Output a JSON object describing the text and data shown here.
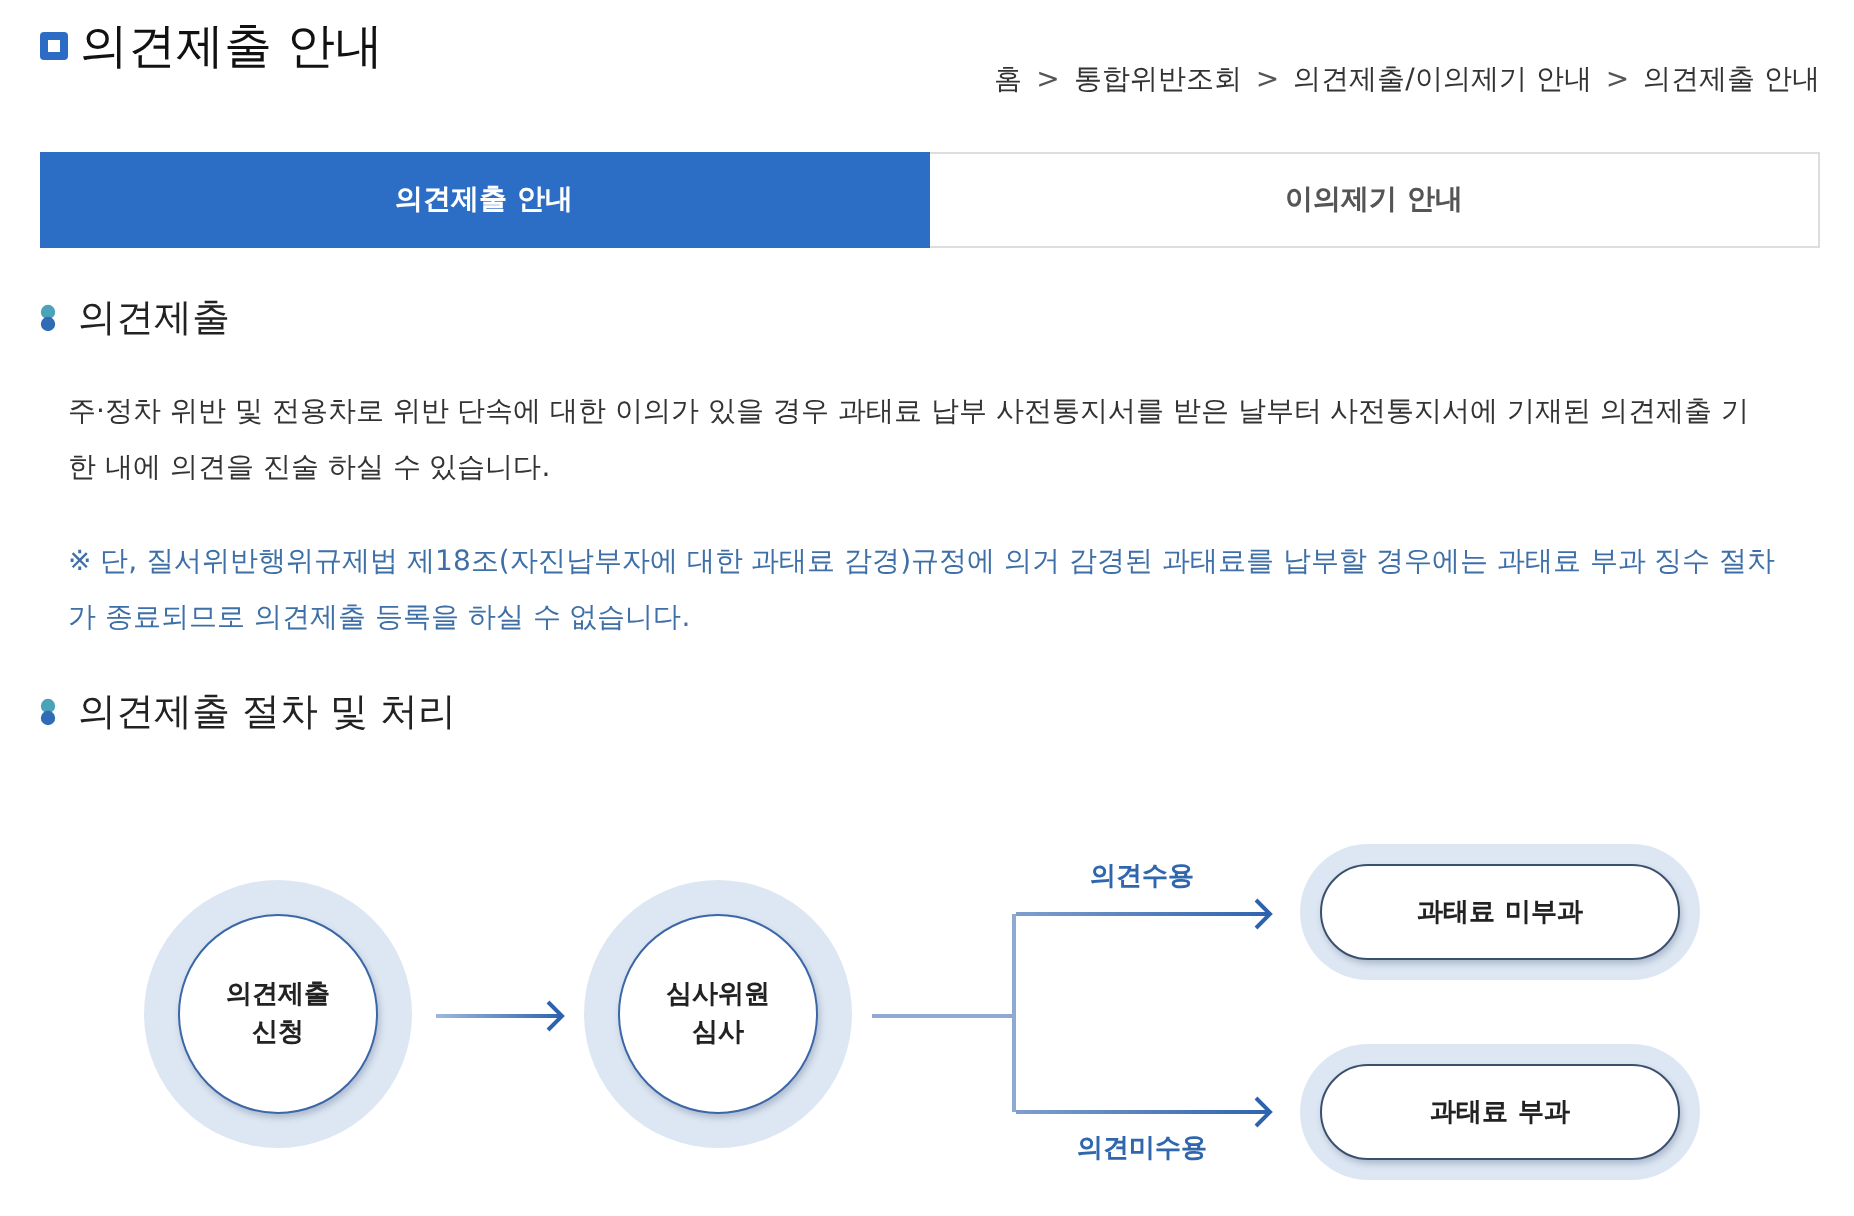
{
  "page": {
    "title": "의견제출 안내"
  },
  "breadcrumb": [
    {
      "kind": "link",
      "text": "홈"
    },
    {
      "kind": "separator",
      "text": ">"
    },
    {
      "kind": "link",
      "text": "통합위반조회"
    },
    {
      "kind": "separator",
      "text": ">"
    },
    {
      "kind": "link",
      "text": "의견제출/이의제기 안내"
    },
    {
      "kind": "separator",
      "text": ">"
    },
    {
      "kind": "link",
      "text": "의견제출 안내"
    }
  ],
  "tabs": [
    {
      "label": "의견제출 안내",
      "selected": true
    },
    {
      "label": "이의제기 안내",
      "selected": false
    }
  ],
  "sections": [
    {
      "heading": "의견제출",
      "paragraphs": [
        {
          "kind": "body",
          "text": "주·정차 위반 및 전용차로 위반 단속에 대한 이의가 있을 경우 과태료 납부 사전통지서를 받은 날부터 사전통지서에 기재된 의견제출 기한 내에 의견을 진술 하실 수 있습니다."
        },
        {
          "kind": "note",
          "text": "※ 단, 질서위반행위규제법 제18조(자진납부자에 대한 과태료 감경)규정에 의거 감경된 과태료를 납부할 경우에는 과태료 부과 징수 절차가 종료되므로 의견제출 등록을 하실 수 없습니다."
        }
      ]
    },
    {
      "heading": "의견제출 절차 및 처리",
      "flow": {
        "steps": [
          {
            "lines": [
              "의견제출",
              "신청"
            ]
          },
          {
            "lines": [
              "심사위원",
              "심사"
            ]
          }
        ],
        "branches": [
          {
            "label": "의견수용",
            "result": "과태료 미부과"
          },
          {
            "label": "의견미수용",
            "result": "과태료 부과"
          }
        ]
      }
    }
  ]
}
